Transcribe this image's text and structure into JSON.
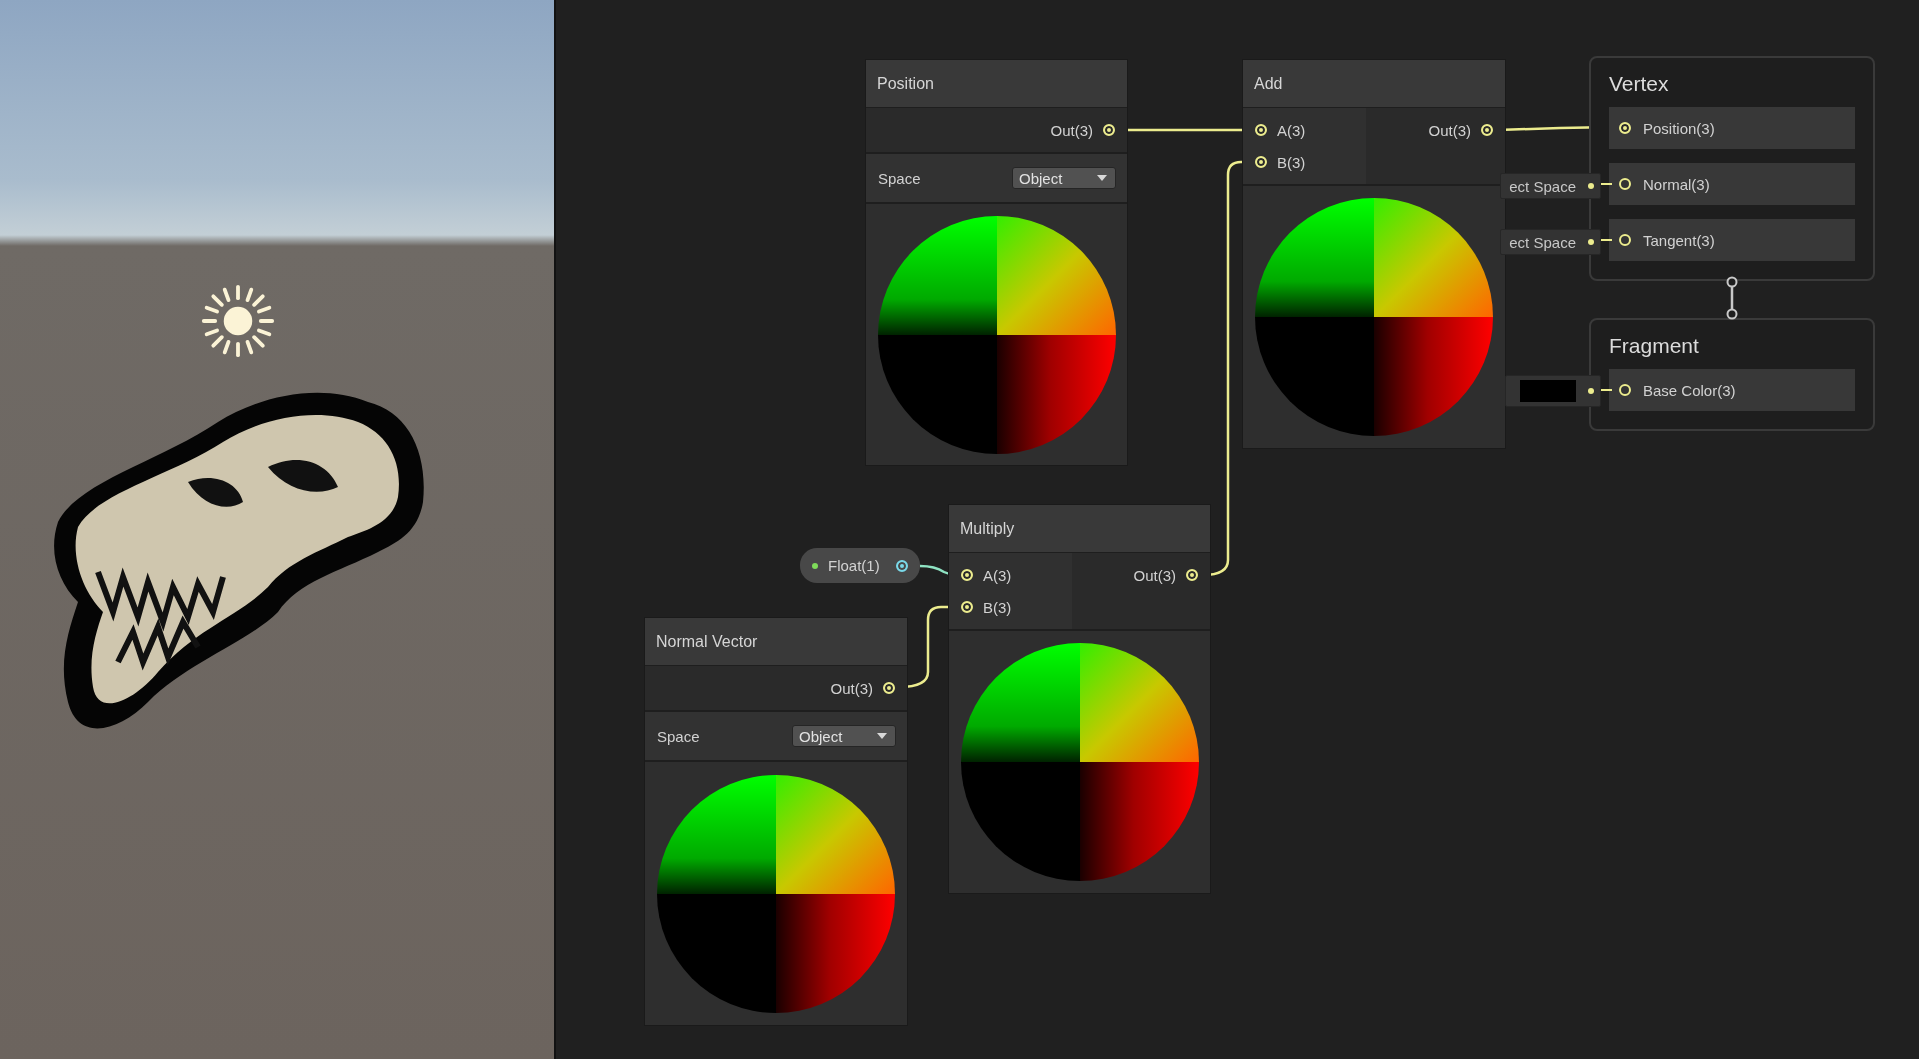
{
  "graph_nodes": [
    {
      "title": "Position",
      "outputs": [
        "Out(3)"
      ],
      "space": {
        "label": "Space",
        "value": "Object"
      }
    },
    {
      "title": "Add",
      "inputs": [
        "A(3)",
        "B(3)"
      ],
      "outputs": [
        "Out(3)"
      ]
    },
    {
      "title": "Multiply",
      "inputs": [
        "A(3)",
        "B(3)"
      ],
      "outputs": [
        "Out(3)"
      ]
    },
    {
      "title": "Normal Vector",
      "outputs": [
        "Out(3)"
      ],
      "space": {
        "label": "Space",
        "value": "Object"
      }
    }
  ],
  "float_property": {
    "label": "Float(1)"
  },
  "master_stack": [
    {
      "title": "Vertex",
      "slots": [
        {
          "label": "Position(3)",
          "kind": "connected"
        },
        {
          "label": "Normal(3)",
          "kind": "space",
          "default": "ect Space"
        },
        {
          "label": "Tangent(3)",
          "kind": "space",
          "default": "ect Space"
        }
      ]
    },
    {
      "title": "Fragment",
      "slots": [
        {
          "label": "Base Color(3)",
          "kind": "color",
          "color": "#000000"
        }
      ]
    }
  ]
}
